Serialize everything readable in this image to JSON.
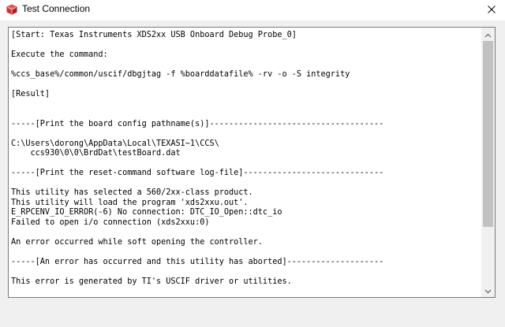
{
  "window": {
    "title": "Test Connection",
    "icon": "ccs-app-icon",
    "close_icon": "close-icon"
  },
  "log": {
    "text": "[Start: Texas Instruments XDS2xx USB Onboard Debug Probe_0]\n\nExecute the command:\n\n%ccs_base%/common/uscif/dbgjtag -f %boarddatafile% -rv -o -S integrity\n\n[Result]\n\n\n-----[Print the board config pathname(s)]------------------------------------\n\nC:\\Users\\dorong\\AppData\\Local\\TEXASI~1\\CCS\\\n    ccs930\\0\\0\\BrdDat\\testBoard.dat\n\n-----[Print the reset-command software log-file]-----------------------------\n\nThis utility has selected a 560/2xx-class product.\nThis utility will load the program 'xds2xxu.out'.\nE_RPCENV_IO_ERROR(-6) No connection: DTC_IO_Open::dtc_io\nFailed to open i/o connection (xds2xxu:0)\n\nAn error occurred while soft opening the controller.\n\n-----[An error has occurred and this utility has aborted]--------------------\n\nThis error is generated by TI's USCIF driver or utilities."
  },
  "scrollbar": {
    "up_icon": "scroll-up-arrow-icon",
    "down_icon": "scroll-down-arrow-icon",
    "position": 0,
    "visible_fraction": 0.69
  },
  "colors": {
    "titlebar_bg": "#ffffff",
    "client_bg": "#f0f0f0",
    "icon_red": "#d32f2f",
    "text": "#000000",
    "thumb": "#c1c1c1"
  }
}
